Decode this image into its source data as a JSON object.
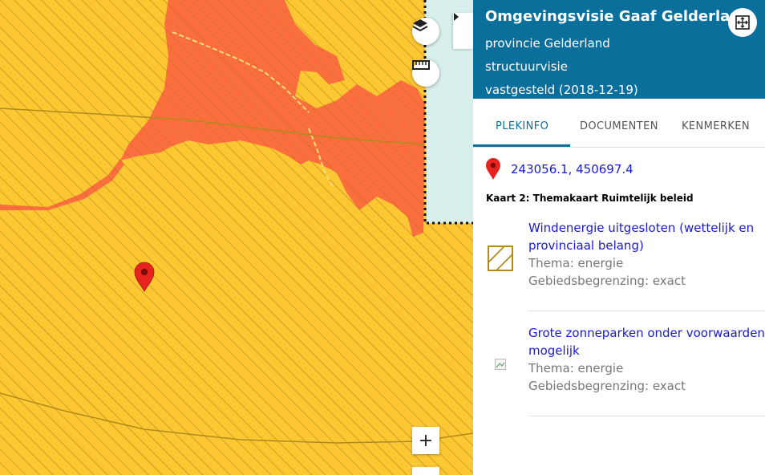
{
  "panel": {
    "title": "Omgevingsvisie Gaaf Gelderland",
    "organization": "provincie Gelderland",
    "plan_type": "structuurvisie",
    "status": "vastgesteld (2018-12-19)",
    "tabs": [
      {
        "label": "PLEKINFO",
        "active": true
      },
      {
        "label": "DOCUMENTEN",
        "active": false
      },
      {
        "label": "KENMERKEN",
        "active": false
      }
    ],
    "coordinates": "243056.1, 450697.4",
    "map_title": "Kaart 2: Themakaart Ruimtelijk beleid",
    "items": [
      {
        "name": "Windenergie uitgesloten (wettelijk en provinciaal belang)",
        "thema": "Thema: energie",
        "begrenzing": "Gebiedsbegrenzing: exact"
      },
      {
        "name": "Grote zonneparken onder voorwaarden mogelijk",
        "thema": "Thema: energie",
        "begrenzing": "Gebiedsbegrenzing: exact"
      }
    ]
  },
  "map": {
    "zoom_in_label": "+",
    "icons": [
      "layers-icon",
      "ruler-icon",
      "location-marker-icon",
      "chevron-right-icon",
      "fit-extent-icon",
      "broken-image-icon"
    ]
  },
  "colors": {
    "header_bg": "#0b6f9c",
    "link": "#1a1ad0",
    "yellow_area": "#fdc733",
    "orange_area": "#fb6e3e",
    "hatch": "#b08a1a",
    "marker": "#e8231f",
    "water": "#d8efec"
  }
}
